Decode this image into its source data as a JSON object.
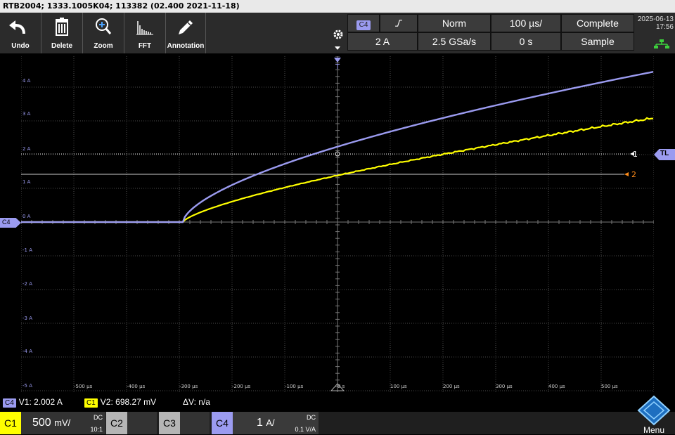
{
  "title": "RTB2004; 1333.1005K04; 113382 (02.400 2021-11-18)",
  "toolbar": {
    "undo": "Undo",
    "delete": "Delete",
    "zoom": "Zoom",
    "fft": "FFT",
    "annotation": "Annotation"
  },
  "header": {
    "trigger_source": "C4",
    "trigger_level": "2 A",
    "trigger_mode": "Norm",
    "sample_rate": "2.5 GSa/s",
    "timebase": "100 µs/",
    "time_offset": "0 s",
    "acq_state": "Complete",
    "acq_mode": "Sample",
    "date": "2025-06-13",
    "time": "17:56"
  },
  "plot": {
    "y_ticks": [
      "4 A",
      "3 A",
      "2 A",
      "1 A",
      "0 A",
      "-1 A",
      "-2 A",
      "-3 A",
      "-4 A",
      "-5 A"
    ],
    "x_ticks": [
      "-500 µs",
      "-400 µs",
      "-300 µs",
      "-200 µs",
      "-100 µs",
      "0 s",
      "100 µs",
      "200 µs",
      "300 µs",
      "400 µs",
      "500 µs"
    ],
    "ch4_marker": "C4",
    "trigger_marker": "T",
    "cursor1_label": "1",
    "cursor2_label": "2",
    "trigger_level_tag": "TL",
    "colors": {
      "ch4": "#9b9bf0",
      "ch1": "#ffff00",
      "cursor2": "#ff8c1a",
      "grid": "#4a4a4a"
    }
  },
  "cursors": {
    "v1_badge": "C4",
    "v1": "V1: 2.002 A",
    "v2_badge": "C1",
    "v2": "V2: 698.27 mV",
    "dv": "ΔV: n/a"
  },
  "channels": [
    {
      "label": "C1",
      "value": "500",
      "unit": "mV/",
      "coupling": "DC",
      "probe": "10:1"
    },
    {
      "label": "C2"
    },
    {
      "label": "C3"
    },
    {
      "label": "C4",
      "value": "1",
      "unit": "A/",
      "coupling": "DC",
      "probe": "0.1 V/A"
    }
  ],
  "menu_label": "Menu"
}
